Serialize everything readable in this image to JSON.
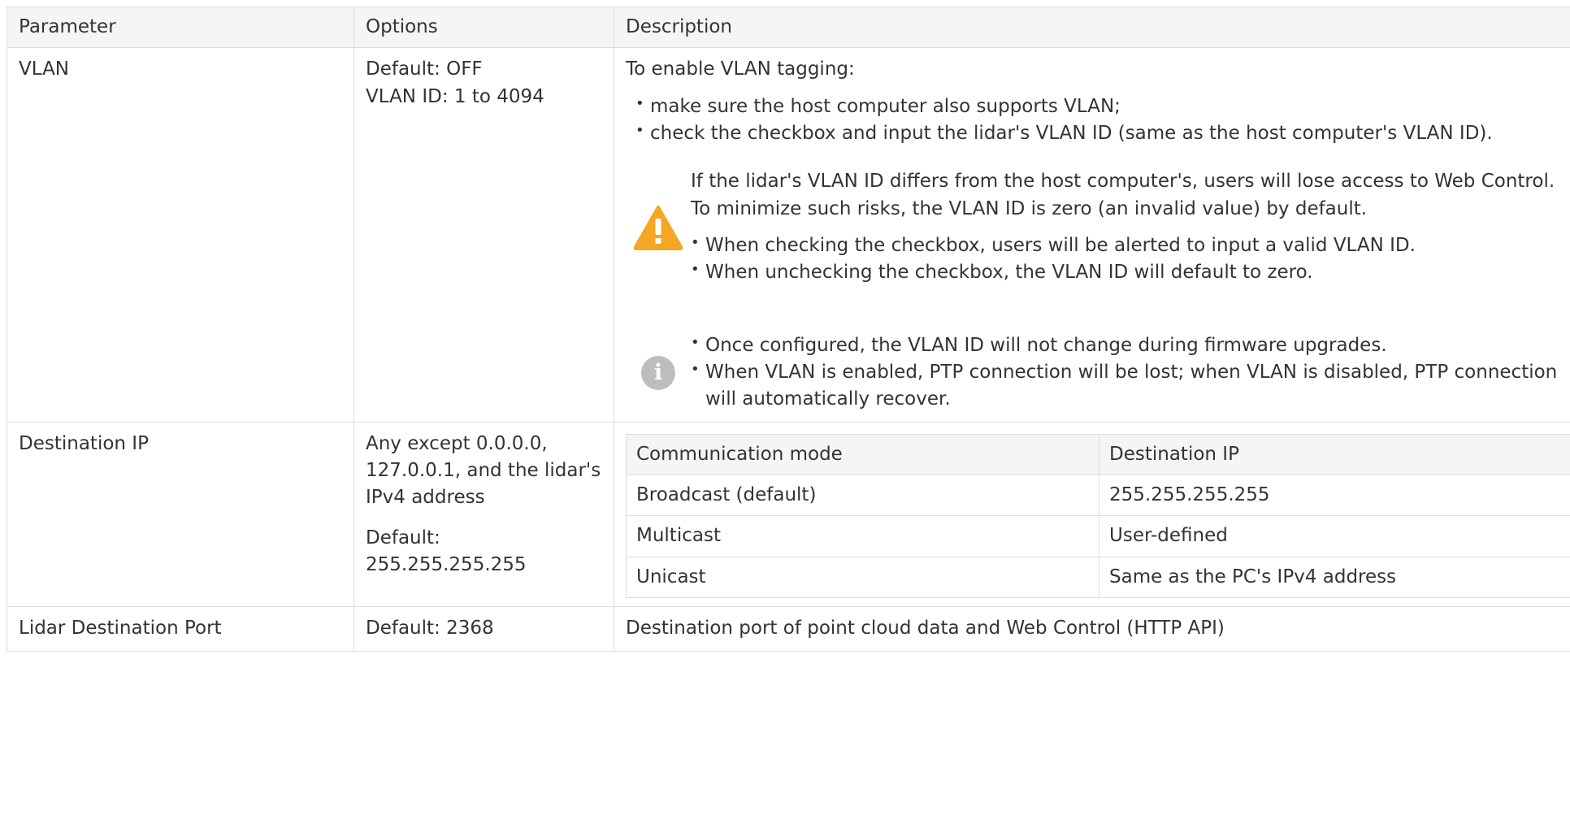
{
  "table": {
    "headers": [
      "Parameter",
      "Options",
      "Description"
    ],
    "vlan": {
      "param": "VLAN",
      "options": [
        "Default: OFF",
        "VLAN ID: 1 to 4094"
      ],
      "intro": "To enable VLAN tagging:",
      "steps": [
        "make sure the host computer also supports VLAN;",
        "check the checkbox and input the lidar's VLAN ID (same as the host computer's VLAN ID)."
      ],
      "warning": {
        "icon": "warning-icon",
        "text": "If the lidar's VLAN ID differs from the host computer's, users will lose access to Web Control. To minimize such risks, the VLAN ID is zero (an invalid value) by default.",
        "items": [
          "When checking the checkbox, users will be alerted to input a valid VLAN ID.",
          "When unchecking the checkbox, the VLAN ID will default to zero."
        ],
        "color": "#f5a623"
      },
      "info": {
        "icon": "info-icon",
        "items": [
          "Once configured, the VLAN ID will not change during firmware upgrades.",
          "When VLAN is enabled, PTP connection will be lost; when VLAN is disabled, PTP connection will automatically recover."
        ],
        "color": "#bdbdbd"
      }
    },
    "dest_ip": {
      "param": "Destination IP",
      "options_text": "Any except 0.0.0.0, 127.0.0.1, and the lidar's IPv4 address",
      "options_default": "Default: 255.255.255.255",
      "modes": {
        "headers": [
          "Communication mode",
          "Destination IP"
        ],
        "rows": [
          [
            "Broadcast (default)",
            "255.255.255.255"
          ],
          [
            "Multicast",
            "User-defined"
          ],
          [
            "Unicast",
            "Same as the PC's IPv4 address"
          ]
        ]
      }
    },
    "dest_port": {
      "param": "Lidar Destination Port",
      "options": "Default: 2368",
      "description": "Destination port of point cloud data and Web Control (HTTP API)"
    }
  }
}
